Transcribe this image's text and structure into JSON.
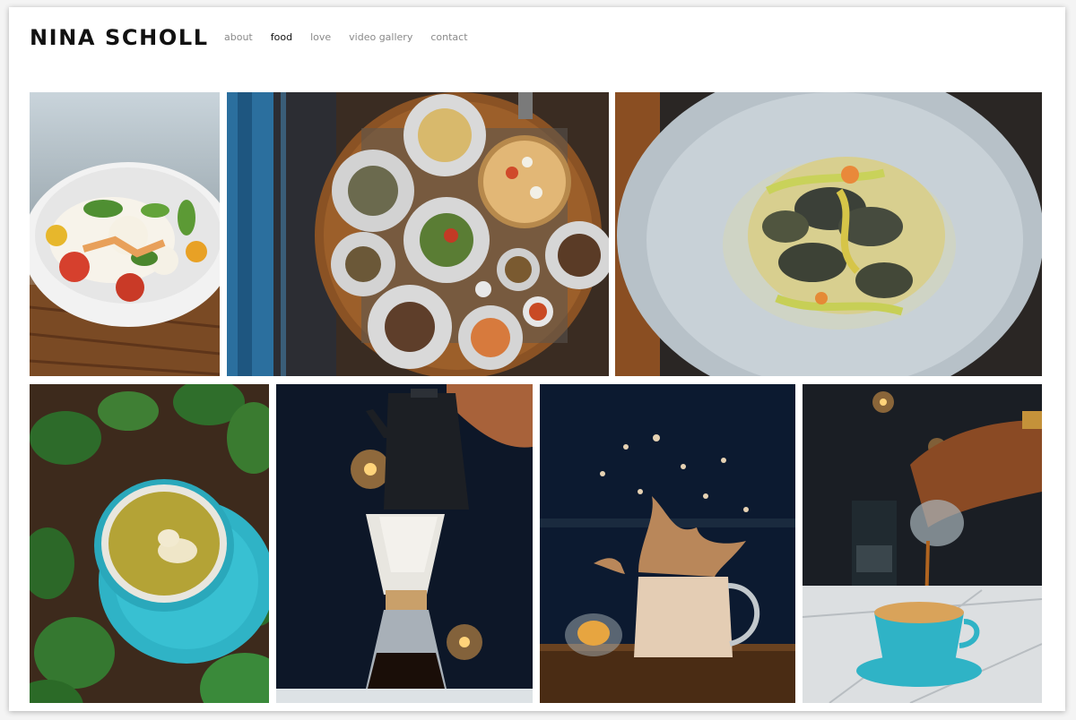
{
  "site": {
    "title": "NINA SCHOLL"
  },
  "nav": {
    "items": [
      {
        "label": "about",
        "active": false
      },
      {
        "label": "food",
        "active": true
      },
      {
        "label": "love",
        "active": false
      },
      {
        "label": "video gallery",
        "active": false
      },
      {
        "label": "contact",
        "active": false
      }
    ]
  },
  "gallery": {
    "photos": [
      {
        "subject": "salad bowl with tomatoes and greens",
        "icon": "salad-photo"
      },
      {
        "subject": "overhead table of pizza and small plates",
        "icon": "table-spread-photo"
      },
      {
        "subject": "pasta with zucchini in grey bowl",
        "icon": "pasta-photo"
      },
      {
        "subject": "matcha latte in teal cup among ivy",
        "icon": "latte-photo"
      },
      {
        "subject": "pour-over coffee with kettle",
        "icon": "pour-over-photo"
      },
      {
        "subject": "splashing iced coffee in glass mug",
        "icon": "splash-photo"
      },
      {
        "subject": "pouring into teal coffee cup on marble",
        "icon": "pouring-coffee-photo"
      }
    ]
  },
  "colors": {
    "accent_teal": "#2fb3c6",
    "nav_active": "#111111",
    "nav_inactive": "#8a8a8a"
  }
}
